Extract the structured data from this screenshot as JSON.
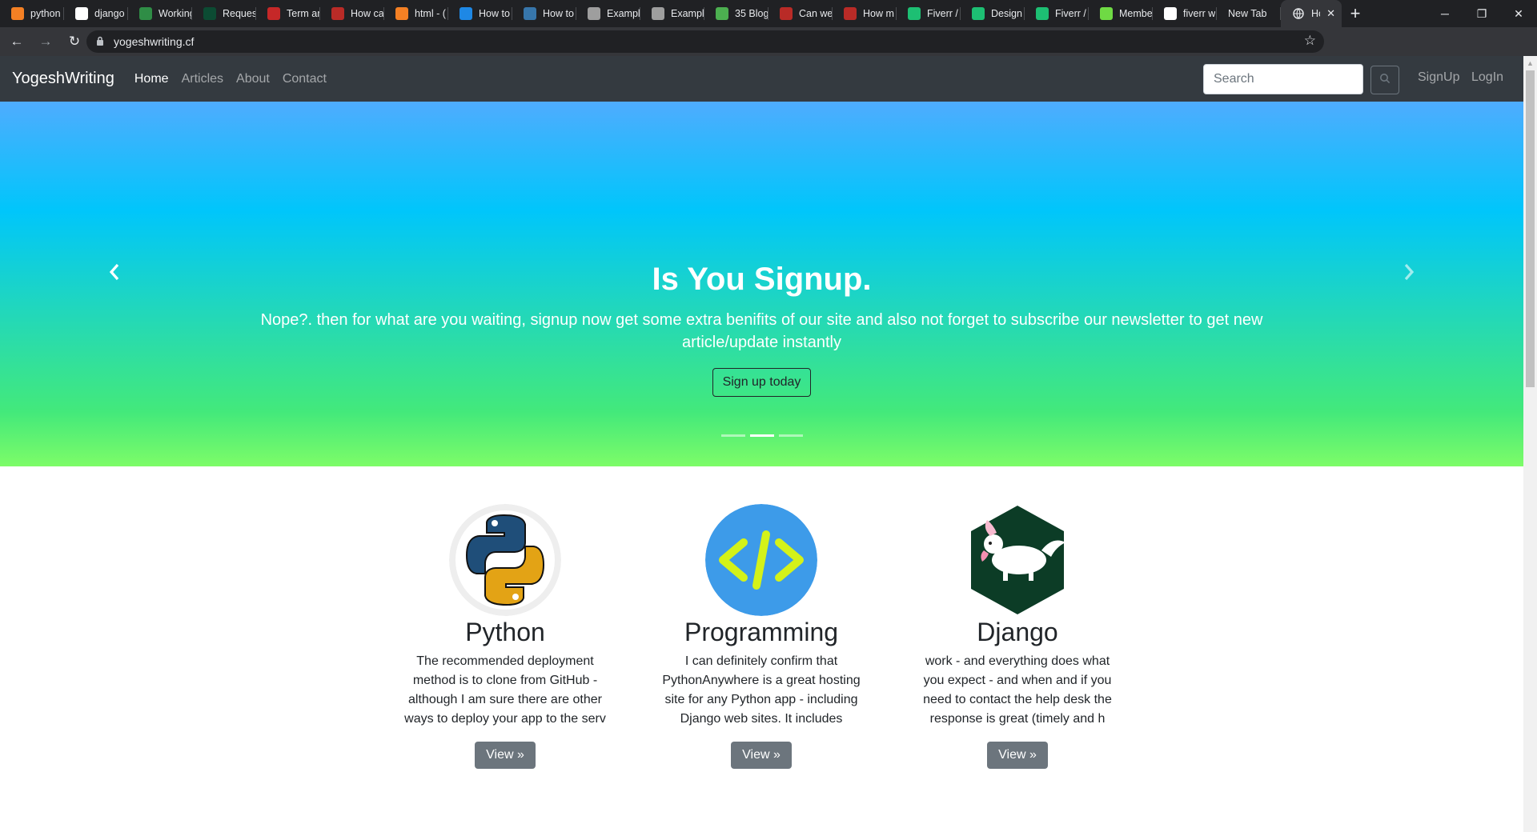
{
  "browser": {
    "tabs": [
      {
        "title": "python",
        "icon": "stackoverflow-icon",
        "color": "#f48024"
      },
      {
        "title": "django",
        "icon": "hexagon-icon",
        "color": "#ffffff"
      },
      {
        "title": "Working",
        "icon": "gfg-icon",
        "color": "#2f8d46"
      },
      {
        "title": "Reques",
        "icon": "django-icon",
        "color": "#0c4b33"
      },
      {
        "title": "Term ar",
        "icon": "term-icon",
        "color": "#c62828"
      },
      {
        "title": "How ca",
        "icon": "quora-icon",
        "color": "#b92b27"
      },
      {
        "title": "html - (",
        "icon": "stackoverflow-icon",
        "color": "#f48024"
      },
      {
        "title": "How to",
        "icon": "s-icon",
        "color": "#1e88e5"
      },
      {
        "title": "How to",
        "icon": "python-icon",
        "color": "#3776ab"
      },
      {
        "title": "Exampl",
        "icon": "doc-icon",
        "color": "#9e9e9e"
      },
      {
        "title": "Exampl",
        "icon": "doc-icon",
        "color": "#9e9e9e"
      },
      {
        "title": "35 Blog",
        "icon": "gear-icon",
        "color": "#4caf50"
      },
      {
        "title": "Can we",
        "icon": "quora-icon",
        "color": "#b92b27"
      },
      {
        "title": "How m",
        "icon": "quora-icon",
        "color": "#b92b27"
      },
      {
        "title": "Fiverr /",
        "icon": "fiverr-icon",
        "color": "#1dbf73"
      },
      {
        "title": "Design",
        "icon": "fiverr-icon",
        "color": "#1dbf73"
      },
      {
        "title": "Fiverr /",
        "icon": "fiverr-icon",
        "color": "#1dbf73"
      },
      {
        "title": "Membe",
        "icon": "upwork-icon",
        "color": "#6fda44"
      },
      {
        "title": "fiverr w",
        "icon": "google-icon",
        "color": "#ffffff"
      },
      {
        "title": "New Tab",
        "icon": "",
        "color": ""
      }
    ],
    "active_tab": {
      "title": "Hor",
      "icon": "globe-icon"
    },
    "url": "yogeshwriting.cf"
  },
  "site": {
    "brand": "YogeshWriting",
    "nav": [
      "Home",
      "Articles",
      "About",
      "Contact"
    ],
    "search_placeholder": "Search",
    "signup": "SignUp",
    "login": "LogIn"
  },
  "carousel": {
    "title": "Is You Signup.",
    "text": "Nope?. then for what are you waiting, signup now get some extra benifits of our site and also not forget to subscribe our newsletter to get new article/update instantly",
    "button": "Sign up today",
    "slide_count": 3,
    "active_slide": 2
  },
  "cards": [
    {
      "title": "Python",
      "text": "The recommended deployment method is to clone from GitHub - although I am sure there are other ways to deploy your app to the serv",
      "button": "View »",
      "icon": "python-logo-icon"
    },
    {
      "title": "Programming",
      "text": "I can definitely confirm that PythonAnywhere is a great hosting site for any Python app - including Django web sites. It includes",
      "button": "View »",
      "icon": "code-icon"
    },
    {
      "title": "Django",
      "text": "work - and everything does what you expect - and when and if you need to contact the help desk the response is great (timely and h",
      "button": "View »",
      "icon": "django-pony-icon"
    }
  ]
}
